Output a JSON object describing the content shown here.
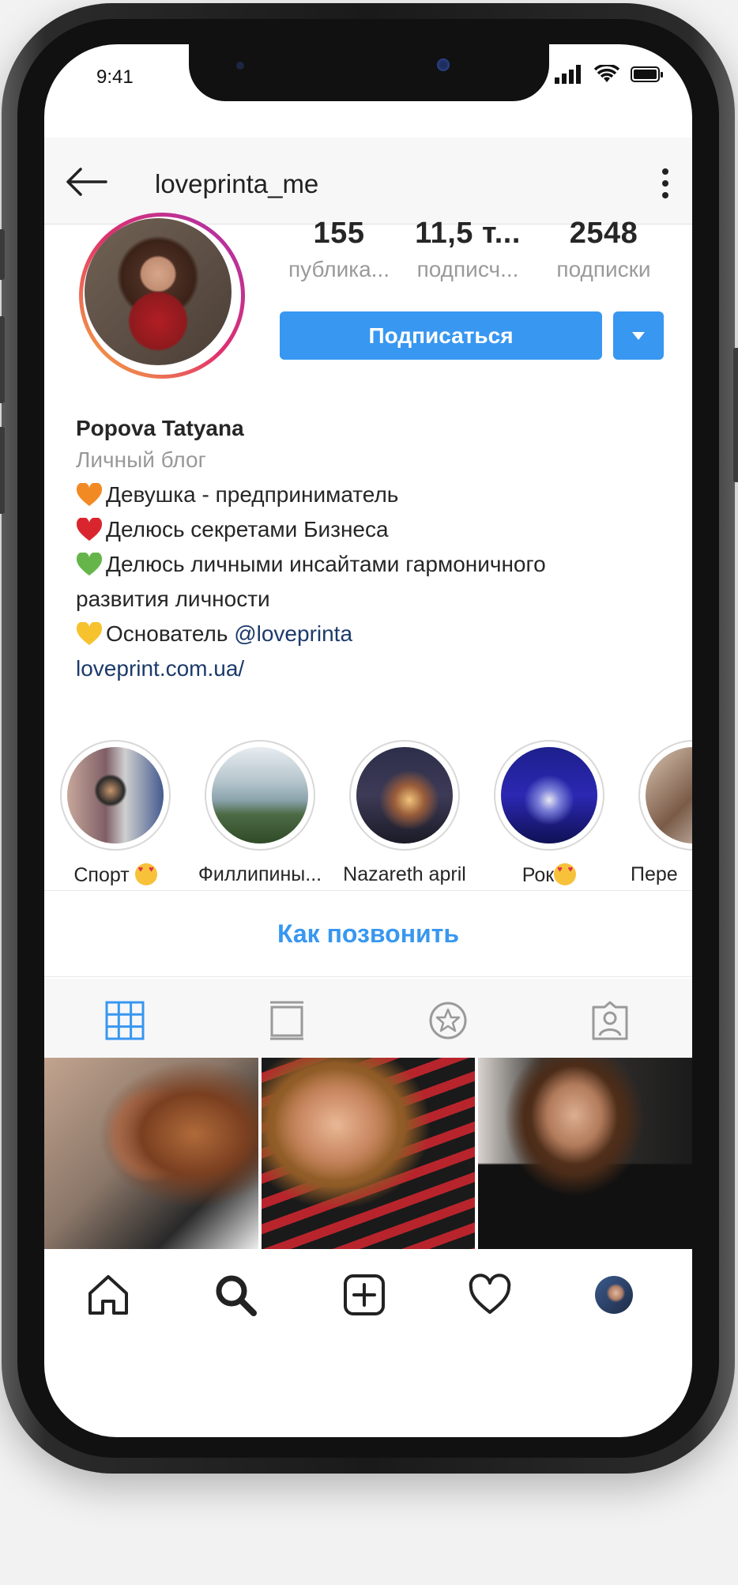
{
  "status_bar": {
    "time": "9:41"
  },
  "header": {
    "username": "loveprinta_me"
  },
  "profile": {
    "stats": [
      {
        "value": "155",
        "label": "публика..."
      },
      {
        "value": "11,5 т...",
        "label": "подписч..."
      },
      {
        "value": "2548",
        "label": "подписки"
      }
    ],
    "follow_label": "Подписаться"
  },
  "bio": {
    "name": "Popova Tatyana",
    "category": "Личный блог",
    "lines": [
      {
        "heart": "orange",
        "text": "Девушка - предприниматель"
      },
      {
        "heart": "red",
        "text": "Делюсь секретами Бизнеса"
      },
      {
        "heart": "green",
        "text": "Делюсь личными инсайтами гармоничного"
      },
      {
        "heart": "",
        "text": "развития личности"
      },
      {
        "heart": "yellow",
        "text": "Основатель ",
        "mention": "@loveprinta"
      }
    ],
    "link": "loveprint.com.ua/"
  },
  "highlights": [
    {
      "label": "Спорт",
      "emoji": "heart-eyes-emoji"
    },
    {
      "label": "Филлипины..."
    },
    {
      "label": "Nazareth april"
    },
    {
      "label": "Рок",
      "emoji": "heart-eyes-emoji"
    },
    {
      "label": "Пере"
    }
  ],
  "call_label": "Как позвонить",
  "tabs": [
    "grid-icon",
    "feed-icon",
    "saved-star-icon",
    "tagged-icon"
  ],
  "bottom_nav": [
    "home-icon",
    "search-icon",
    "add-post-icon",
    "heart-icon",
    "profile-avatar"
  ],
  "colors": {
    "accent": "#3897f0",
    "link": "#1b3a6b",
    "heart_orange": "#f28a24",
    "heart_red": "#d9262e",
    "heart_green": "#66b54a",
    "heart_yellow": "#f6c32e"
  }
}
